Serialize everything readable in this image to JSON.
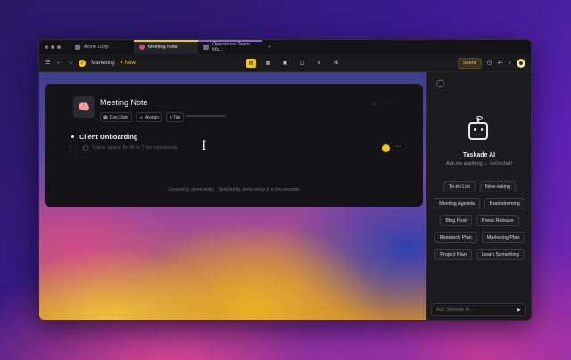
{
  "tabs": [
    {
      "label": "Acme Corp",
      "active": false
    },
    {
      "label": "Meeting Note",
      "active": true
    },
    {
      "label": "Operations Team Ma...",
      "active": false
    }
  ],
  "toolbar": {
    "workspace": "Marketing",
    "new_label": "+ New",
    "share_label": "Share"
  },
  "note": {
    "title": "Meeting Note",
    "icon": "brain-icon",
    "chips": {
      "due_date": "Due Date",
      "assign": "Assign",
      "tag": "+ Tag"
    },
    "bullet": "Client Onboarding",
    "placeholder": "Press 'space' for AI or '/' for commands",
    "footer": "Created by demo-emily · Updated by demo-emily in a few seconds"
  },
  "panel": {
    "title": "Taskade AI",
    "subtitle": "Ask me anything → Let's chat!",
    "prompts": [
      "To-do List",
      "Note-taking",
      "Meeting Agenda",
      "Brainstorming",
      "Blog Post",
      "Press Release",
      "Research Plan",
      "Marketing Plan",
      "Project Plan",
      "Learn Something"
    ],
    "input_placeholder": "Ask Taskade AI..."
  },
  "colors": {
    "accent": "#f2c418",
    "window_bg": "#1c1c1f",
    "card_bg": "#141417"
  }
}
